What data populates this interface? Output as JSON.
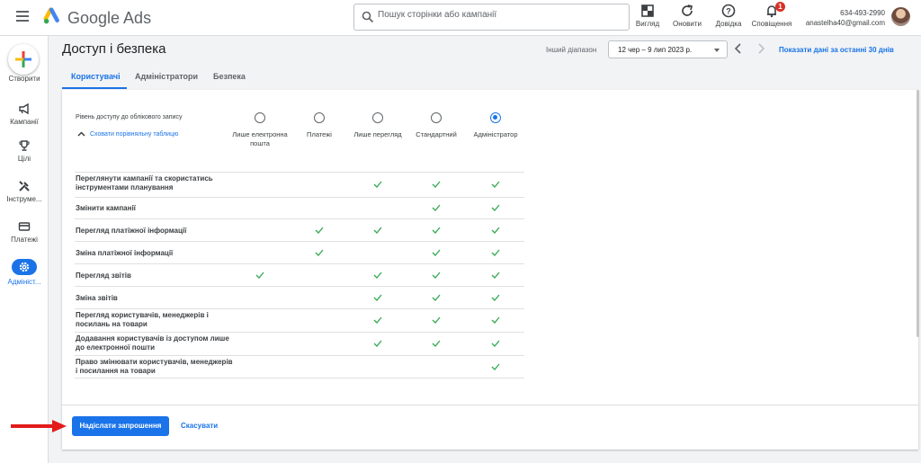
{
  "app": {
    "brand": "Google Ads",
    "search_placeholder": "Пошук сторінки або кампанії"
  },
  "toolbar": [
    {
      "label": "Вигляд",
      "icon": "view-icon"
    },
    {
      "label": "Оновити",
      "icon": "refresh-icon"
    },
    {
      "label": "Довідка",
      "icon": "help-icon"
    },
    {
      "label": "Сповіщення",
      "icon": "bell-icon",
      "badge": "1"
    }
  ],
  "account": {
    "id": "634-493-2990",
    "email": "anastelha40@gmail.com"
  },
  "sidebar": {
    "create_label": "Створити",
    "items": [
      {
        "label": "Кампанії",
        "icon": "megaphone-icon"
      },
      {
        "label": "Цілі",
        "icon": "trophy-icon"
      },
      {
        "label": "Інструме...",
        "icon": "tools-icon"
      },
      {
        "label": "Платежі",
        "icon": "card-icon"
      },
      {
        "label": "Адмініст...",
        "icon": "gear-icon",
        "active": true
      }
    ]
  },
  "header": {
    "title": "Доступ і безпека",
    "range_label": "Інший діапазон",
    "date_range": "12 чер – 9 лип 2023 р.",
    "last_30": "Показати дані за останні 30 днів"
  },
  "tabs": [
    {
      "label": "Користувачі",
      "active": true
    },
    {
      "label": "Адміністратори"
    },
    {
      "label": "Безпека"
    }
  ],
  "access": {
    "label": "Рівень доступу до облікового запису",
    "hide_link": "Сховати порівняльну таблицю",
    "levels": [
      {
        "label": "Лише електронна пошта",
        "selected": false
      },
      {
        "label": "Платежі",
        "selected": false
      },
      {
        "label": "Лише перегляд",
        "selected": false
      },
      {
        "label": "Стандартний",
        "selected": false
      },
      {
        "label": "Адміністратор",
        "selected": true
      }
    ],
    "rows": [
      {
        "label": "Переглянути кампанії та скористатись інструментами планування",
        "checks": [
          false,
          false,
          true,
          true,
          true
        ]
      },
      {
        "label": "Змінити кампанії",
        "checks": [
          false,
          false,
          false,
          true,
          true
        ]
      },
      {
        "label": "Перегляд платіжної інформації",
        "checks": [
          false,
          true,
          true,
          true,
          true
        ]
      },
      {
        "label": "Зміна платіжної інформації",
        "checks": [
          false,
          true,
          false,
          true,
          true
        ]
      },
      {
        "label": "Перегляд звітів",
        "checks": [
          true,
          false,
          true,
          true,
          true
        ]
      },
      {
        "label": "Зміна звітів",
        "checks": [
          false,
          false,
          true,
          true,
          true
        ]
      },
      {
        "label": "Перегляд користувачів, менеджерів і посилань на товари",
        "checks": [
          false,
          false,
          true,
          true,
          true
        ]
      },
      {
        "label": "Додавання користувачів із доступом лише до електронної пошти",
        "checks": [
          false,
          false,
          true,
          true,
          true
        ]
      },
      {
        "label": "Право змінювати користувачів, менеджерів і посилання на товари",
        "checks": [
          false,
          false,
          false,
          false,
          true
        ]
      }
    ]
  },
  "actions": {
    "send": "Надіслати запрошення",
    "cancel": "Скасувати"
  },
  "colors": {
    "accent": "#1a73e8",
    "check": "#34a853",
    "arrow": "#e21b1b"
  }
}
